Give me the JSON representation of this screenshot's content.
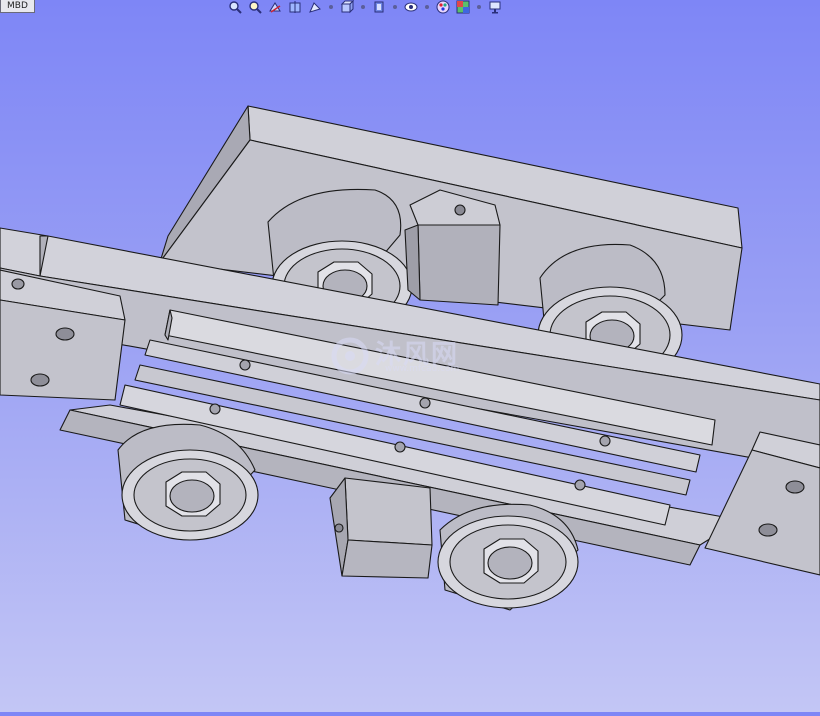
{
  "tab": {
    "label": "MBD"
  },
  "toolbar": {
    "buttons": [
      {
        "icon": "zoom-to-fit-icon"
      },
      {
        "icon": "zoom-to-area-icon"
      },
      {
        "icon": "previous-view-icon"
      },
      {
        "icon": "section-view-icon"
      },
      {
        "icon": "dynamic-annotation-icon"
      },
      {
        "icon": "view-orientation-icon"
      },
      {
        "icon": "display-style-icon"
      },
      {
        "icon": "hide-show-items-icon"
      },
      {
        "icon": "edit-appearance-icon"
      },
      {
        "icon": "apply-scene-icon"
      },
      {
        "icon": "view-settings-icon"
      }
    ]
  },
  "watermark": {
    "text": "沐风网",
    "url": "www.mfcad.com"
  },
  "colors": {
    "background_top": "#7e86f6",
    "background_bottom": "#c3c6f5",
    "part_light": "#d4d4da",
    "part_mid": "#b9b9c2",
    "part_dark": "#9e9ea8",
    "edge": "#1a1a1a"
  }
}
